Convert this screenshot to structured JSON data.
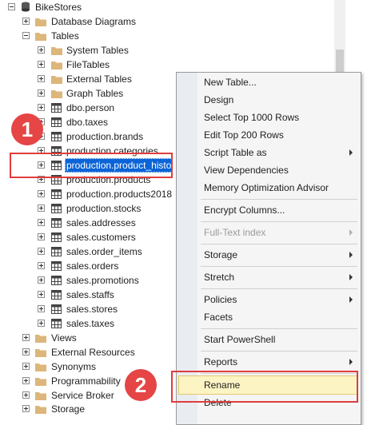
{
  "tree": {
    "root": "BikeStores",
    "nodes": [
      "Database Diagrams",
      "Tables",
      "System Tables",
      "FileTables",
      "External Tables",
      "Graph Tables",
      "dbo.person",
      "dbo.taxes",
      "production.brands",
      "production.categories",
      "production.product_histo",
      "production.products",
      "production.products2018",
      "production.stocks",
      "sales.addresses",
      "sales.customers",
      "sales.order_items",
      "sales.orders",
      "sales.promotions",
      "sales.staffs",
      "sales.stores",
      "sales.taxes",
      "Views",
      "External Resources",
      "Synonyms",
      "Programmability",
      "Service Broker",
      "Storage"
    ]
  },
  "context_menu": {
    "items": [
      "New Table...",
      "Design",
      "Select Top 1000 Rows",
      "Edit Top 200 Rows",
      "Script Table as",
      "View Dependencies",
      "Memory Optimization Advisor",
      "Encrypt Columns...",
      "Full-Text index",
      "Storage",
      "Stretch",
      "Policies",
      "Facets",
      "Start PowerShell",
      "Reports",
      "Rename",
      "Delete"
    ]
  },
  "annotations": {
    "step1": "1",
    "step2": "2"
  },
  "colors": {
    "selection": "#0a64d8",
    "annotation_red": "#e54545",
    "menu_highlight": "#fdf4c4",
    "folder": "#dcb67a"
  },
  "icons": {
    "server_db": "database-icon",
    "folder": "folder-icon",
    "table": "table-icon"
  }
}
